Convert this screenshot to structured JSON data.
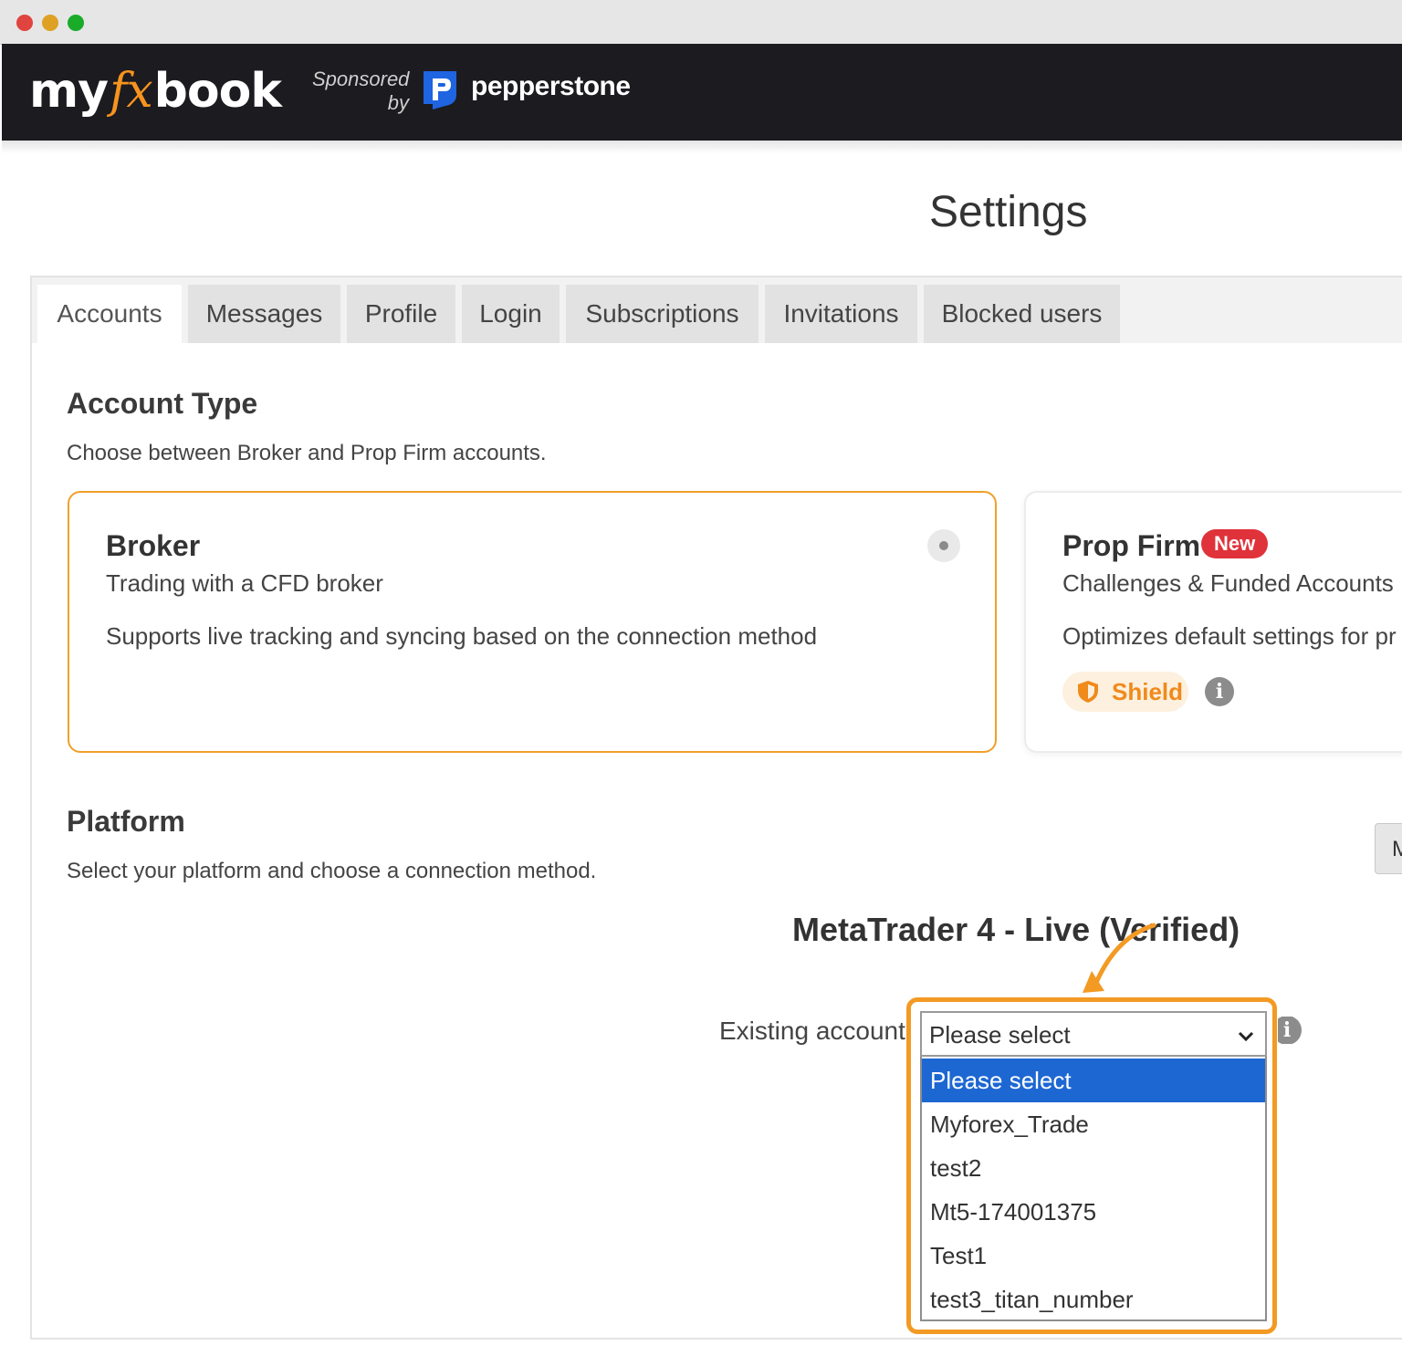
{
  "header": {
    "logo_pre": "my",
    "logo_fx": "fx",
    "logo_post": "book",
    "sponsored_line1": "Sponsored",
    "sponsored_line2": "by",
    "sponsor_name": "pepperstone",
    "sponsor_icon": "pepperstone-p-icon"
  },
  "page": {
    "title": "Settings"
  },
  "tabs": [
    {
      "label": "Accounts",
      "active": true
    },
    {
      "label": "Messages"
    },
    {
      "label": "Profile"
    },
    {
      "label": "Login"
    },
    {
      "label": "Subscriptions"
    },
    {
      "label": "Invitations"
    },
    {
      "label": "Blocked users"
    }
  ],
  "account_type": {
    "title": "Account Type",
    "description": "Choose between Broker and Prop Firm accounts.",
    "broker": {
      "title": "Broker",
      "subtitle": "Trading with a CFD broker",
      "description": "Supports live tracking and syncing based on the connection method"
    },
    "prop_firm": {
      "title": "Prop Firm",
      "badge": "New",
      "subtitle": "Challenges & Funded Accounts",
      "description": "Optimizes default settings for pr",
      "shield_label": "Shield",
      "shield_icon": "shield-icon",
      "info_icon": "info-icon"
    }
  },
  "platform": {
    "title": "Platform",
    "description": "Select your platform and choose a connection method.",
    "side_button_label": "M",
    "platform_name": "MetaTrader 4 - Live (Verified)",
    "existing_account": {
      "label": "Existing account",
      "selected": "Please select",
      "options": [
        "Please select",
        "Myforex_Trade",
        "test2",
        "Mt5-174001375",
        "Test1",
        "test3_titan_number"
      ]
    }
  },
  "colors": {
    "header_bg": "#1b1b20",
    "accent_orange": "#f39a24",
    "badge_red": "#e0323a",
    "selected_option_blue": "#1d67d3"
  }
}
